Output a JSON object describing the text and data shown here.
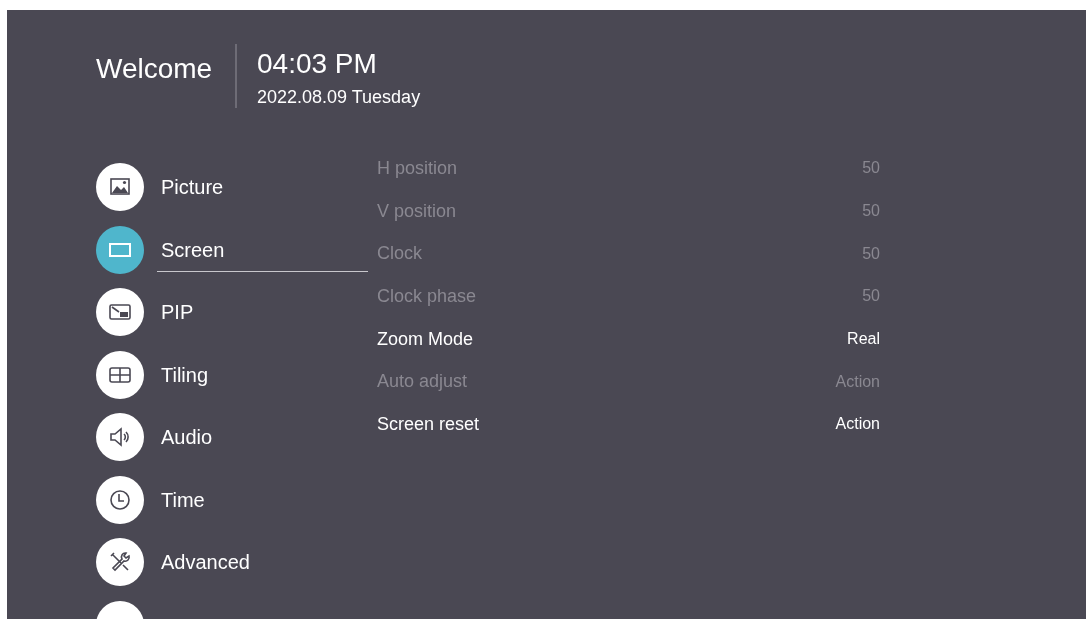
{
  "header": {
    "greeting": "Welcome",
    "time": "04:03 PM",
    "date": "2022.08.09 Tuesday"
  },
  "menu": [
    {
      "label": "Picture",
      "selected": false
    },
    {
      "label": "Screen",
      "selected": true
    },
    {
      "label": "PIP",
      "selected": false
    },
    {
      "label": "Tiling",
      "selected": false
    },
    {
      "label": "Audio",
      "selected": false
    },
    {
      "label": "Time",
      "selected": false
    },
    {
      "label": "Advanced",
      "selected": false
    }
  ],
  "settings": [
    {
      "label": "H position",
      "value": "50",
      "disabled": true
    },
    {
      "label": "V position",
      "value": "50",
      "disabled": true
    },
    {
      "label": "Clock",
      "value": "50",
      "disabled": true
    },
    {
      "label": "Clock phase",
      "value": "50",
      "disabled": true
    },
    {
      "label": "Zoom Mode",
      "value": "Real",
      "disabled": false
    },
    {
      "label": "Auto adjust",
      "value": "Action",
      "disabled": true
    },
    {
      "label": "Screen reset",
      "value": "Action",
      "disabled": false
    }
  ]
}
